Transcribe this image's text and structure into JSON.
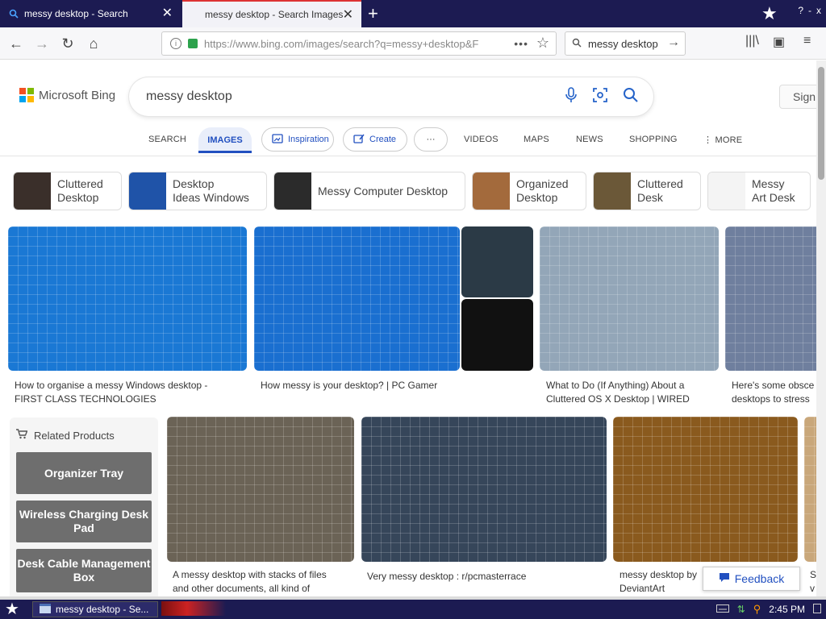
{
  "browser": {
    "tabs": [
      {
        "title": "messy desktop - Search",
        "active": false
      },
      {
        "title": "messy desktop - Search Images",
        "active": true
      }
    ],
    "new_tab": "+",
    "url": "https://www.bing.com/images/search?q=messy+desktop&F",
    "url_display": "https://www.bing.com/images/search?q=messy+desktop&F",
    "search_value": "messy desktop",
    "window_controls": [
      "?",
      "-",
      "x"
    ]
  },
  "header": {
    "logo": "Microsoft Bing",
    "query": "messy desktop",
    "signin": "Sign"
  },
  "scopes": {
    "search": "SEARCH",
    "images": "IMAGES",
    "inspiration": "Inspiration",
    "create": "Create",
    "more_dots": "···",
    "videos": "VIDEOS",
    "maps": "MAPS",
    "news": "NEWS",
    "shopping": "SHOPPING",
    "more": "MORE"
  },
  "chips": [
    {
      "l1": "Cluttered",
      "l2": "Desktop",
      "thumb": "#3a2f2a"
    },
    {
      "l1": "Desktop",
      "l2": "Ideas Windows",
      "thumb": "#1f53a8"
    },
    {
      "l1": "Messy Computer Desktop",
      "l2": "",
      "thumb": "#2b2b2b"
    },
    {
      "l1": "Organized",
      "l2": "Desktop",
      "thumb": "#a36a3c"
    },
    {
      "l1": "Cluttered",
      "l2": "Desk",
      "thumb": "#6b5838"
    },
    {
      "l1": "Messy",
      "l2": "Art Desk",
      "thumb": "#f4f4f4"
    }
  ],
  "results": [
    {
      "caption_1": "How to organise a messy Windows desktop -",
      "caption_2": "FIRST CLASS TECHNOLOGIES",
      "color": "#1a78d4"
    },
    {
      "caption_1": "How messy is your desktop? | PC Gamer",
      "caption_2": "",
      "color": "#1a6fd0"
    },
    {
      "caption_1": "What to Do (If Anything) About a",
      "caption_2": "Cluttered OS X Desktop | WIRED",
      "color": "#93a6b8"
    },
    {
      "caption_1": "Here's some obsce",
      "caption_2": "desktops to stress",
      "color": "#6f7f9e"
    },
    {
      "caption_1": "A messy desktop with stacks of files",
      "caption_2": "and other documents, all kind of",
      "color": "#6b6356"
    },
    {
      "caption_1": "Very messy desktop : r/pcmasterrace",
      "caption_2": "",
      "color": "#36465a"
    },
    {
      "caption_1": "messy desktop by",
      "caption_2": "DeviantArt",
      "color": "#8a5a1e"
    },
    {
      "caption_1": "S",
      "caption_2": "v",
      "color": "#c9a77a"
    }
  ],
  "related": {
    "title": "Related Products",
    "items": [
      "Organizer Tray",
      "Wireless Charging Desk Pad",
      "Desk Cable Management Box"
    ]
  },
  "feedback": "Feedback",
  "taskbar": {
    "item": "messy desktop - Se...",
    "time": "2:45 PM"
  },
  "colors": {
    "ms_red": "#f25022",
    "ms_green": "#7fba00",
    "ms_blue": "#00a4ef",
    "ms_yellow": "#ffb900",
    "accent": "#2250c0"
  }
}
